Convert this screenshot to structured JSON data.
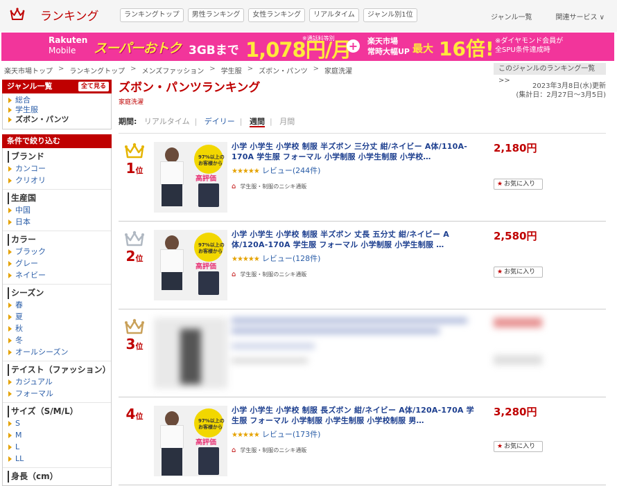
{
  "header": {
    "logo_text": "ランキング",
    "nav": [
      "ランキングトップ",
      "男性ランキング",
      "女性ランキング",
      "リアルタイム",
      "ジャンル別1位"
    ],
    "right_links": [
      "ジャンル一覧",
      "関連サービス ∨"
    ]
  },
  "banner": {
    "brand_line1": "Rakuten",
    "brand_line2": "Mobile",
    "campaign": "スーパーおトク",
    "data": "3GBまで",
    "price": "1,078円/月",
    "price_note": "※通話料等別",
    "market_line1": "楽天市場",
    "market_line2": "常時大幅UP",
    "max": "最大",
    "multiplier": "16倍!",
    "diamond_line1": "※ダイヤモンド会員が",
    "diamond_line2": "全SPU条件達成時"
  },
  "breadcrumb": [
    "楽天市場トップ",
    "ランキングトップ",
    "メンズファッション",
    "学生服",
    "ズボン・パンツ",
    "家庭洗濯"
  ],
  "breadcrumb_right": "このジャンルのランキング一覧 >>",
  "sidebar": {
    "genre_title": "ジャンル一覧",
    "see_all": "全て見る",
    "genres": [
      "総合",
      "学生服",
      "ズボン・パンツ"
    ],
    "filter_title": "条件で絞り込む",
    "groups": [
      {
        "title": "ブランド",
        "options": [
          "カンコー",
          "クリオリ"
        ]
      },
      {
        "title": "生産国",
        "options": [
          "中国",
          "日本"
        ]
      },
      {
        "title": "カラー",
        "options": [
          "ブラック",
          "グレー",
          "ネイビー"
        ]
      },
      {
        "title": "シーズン",
        "options": [
          "春",
          "夏",
          "秋",
          "冬",
          "オールシーズン"
        ]
      },
      {
        "title": "テイスト（ファッション）",
        "options": [
          "カジュアル",
          "フォーマル"
        ]
      },
      {
        "title": "サイズ（S/M/L）",
        "options": [
          "S",
          "M",
          "L",
          "LL"
        ]
      },
      {
        "title": "身長（cm）",
        "options": []
      }
    ]
  },
  "main": {
    "title": "ズボン・パンツランキング",
    "subtitle": "家庭洗濯",
    "updated": "2023年3月8日(水)更新",
    "period_range": "(集計日：2月27日～3月5日)",
    "period_label": "期間:",
    "periods": [
      "リアルタイム",
      "デイリー",
      "週間",
      "月間"
    ],
    "items": [
      {
        "rank": "1",
        "rank_suffix": "位",
        "name": "小学 小学生 小学校 制服 半ズボン 三分丈 紺/ネイビー A体/110A-170A 学生服 フォーマル 小学制服 小学生制服 小学校…",
        "rating": "★★★★★",
        "review": "レビュー(244件)",
        "shop": "学生服・制服のニシキ通販",
        "price": "2,180円",
        "fav": "お気に入り",
        "badge_line1": "97%以上の",
        "badge_line2": "お客様から",
        "badge_hi": "高評価",
        "crown_color": "#e5b400"
      },
      {
        "rank": "2",
        "rank_suffix": "位",
        "name": "小学 小学生 小学校 制服 半ズボン 丈長 五分丈 紺/ネイビー A体/120A-170A 学生服 フォーマル 小学制服 小学生制服 …",
        "rating": "★★★★★",
        "review": "レビュー(128件)",
        "shop": "学生服・制服のニシキ通販",
        "price": "2,580円",
        "fav": "お気に入り",
        "badge_line1": "97%以上の",
        "badge_line2": "お客様から",
        "badge_hi": "高評価",
        "crown_color": "#b0b8c2"
      },
      {
        "rank": "3",
        "rank_suffix": "位",
        "crown_color": "#c9a15a"
      },
      {
        "rank": "4",
        "rank_suffix": "位",
        "name": "小学 小学生 小学校 制服 長ズボン 紺/ネイビー A体/120A-170A 学生服 フォーマル 小学制服 小学生制服 小学校制服 男…",
        "rating": "★★★★★",
        "review": "レビュー(173件)",
        "shop": "学生服・制服のニシキ通販",
        "price": "3,280円",
        "fav": "お気に入り",
        "badge_line1": "97%以上の",
        "badge_line2": "お客様から",
        "badge_hi": "高評価"
      }
    ]
  }
}
